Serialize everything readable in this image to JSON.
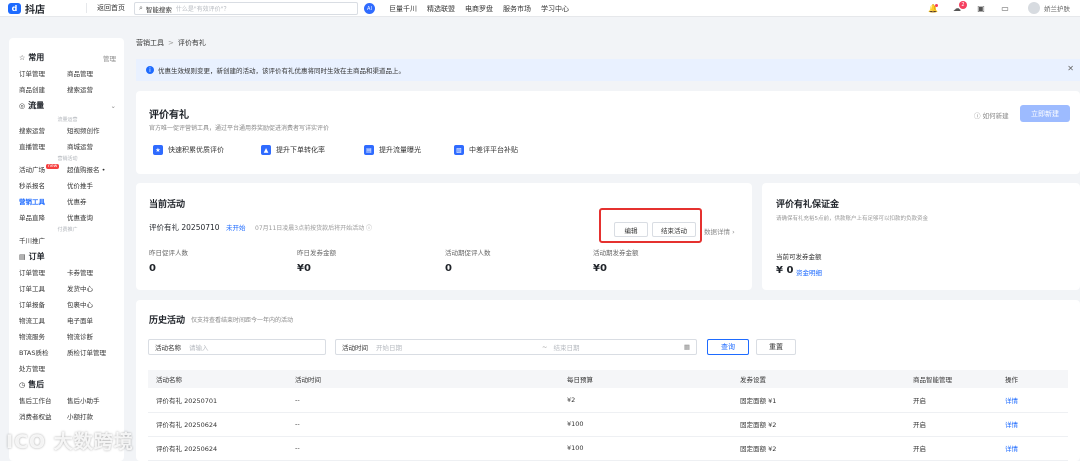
{
  "topbar": {
    "logo_text": "抖店",
    "back_home": "返回首页",
    "search_label": "智能搜索",
    "search_placeholder": "什么是\"有效评价\"？",
    "ai_label": "AI",
    "nav": [
      "巨量千川",
      "精选联盟",
      "电商罗盘",
      "服务市场",
      "学习中心"
    ],
    "badge_count": "2",
    "user_name": "娇兰护肤"
  },
  "sidebar": {
    "sections": [
      {
        "title": "常用",
        "right": "管理",
        "icon": "star-icon",
        "groups": [
          {
            "items": [
              "订单管理",
              "商品管理",
              "商品创建",
              "搜索运营"
            ]
          }
        ]
      },
      {
        "title": "流量",
        "right": "⌄",
        "icon": "flow-icon",
        "groups": [
          {
            "sub": "流量运营",
            "items": [
              "搜索运营",
              "短视频创作",
              "直播管理",
              "商城运营"
            ]
          },
          {
            "sub": "营销活动",
            "items": [
              "活动广场",
              "超值购报名 •",
              "秒杀报名",
              "优价推手",
              "营销工具",
              "优惠券",
              "单品直降",
              "优惠查询"
            ]
          },
          {
            "sub": "付费推广",
            "items": [
              "千川推广"
            ]
          }
        ]
      },
      {
        "title": "订单",
        "right": "",
        "icon": "order-icon",
        "groups": [
          {
            "items": [
              "订单管理",
              "卡券管理",
              "订单工具",
              "发货中心",
              "订单报备",
              "包裹中心",
              "物流工具",
              "电子面单",
              "物流服务",
              "物流诊断",
              "BTAS质检",
              "质检订单管理",
              "处方管理"
            ]
          }
        ]
      },
      {
        "title": "售后",
        "right": "",
        "icon": "aftersale-icon",
        "groups": [
          {
            "items": [
              "售后工作台",
              "售后小助手",
              "消费者权益",
              "小额打款"
            ]
          }
        ]
      }
    ]
  },
  "breadcrumb": {
    "parent": "营销工具",
    "sep": ">",
    "current": "评价有礼"
  },
  "notice": {
    "text": "优惠生效规则变更，新创建的活动，该评价有礼优惠将同时生效在主商品和渠道品上。",
    "close": "✕"
  },
  "header": {
    "title": "评价有礼",
    "desc": "官方唯一促评营销工具，通过平台通用券奖励促进消费者写详实评价",
    "how_to": "如何新建",
    "create_btn": "立即新建",
    "features": [
      "快速积累优质评价",
      "提升下单转化率",
      "提升流量曝光",
      "中差评平台补贴"
    ]
  },
  "current": {
    "title": "当前活动",
    "activity_name": "评价有礼 20250710",
    "status": "未开始",
    "start_note": "07月11日凌晨3点前按货款后将开始活动",
    "edit_btn": "编辑",
    "end_btn": "结束活动",
    "detail_link": "数据详情",
    "stats": [
      {
        "label": "昨日促评人数",
        "value": "0"
      },
      {
        "label": "昨日发券金额",
        "value": "¥0"
      },
      {
        "label": "活动期促评人数",
        "value": "0"
      },
      {
        "label": "活动期发券金额",
        "value": "¥0"
      }
    ]
  },
  "deposit": {
    "title": "评价有礼保证金",
    "desc": "请确保有礼充裕5点前，供款账户上有足够可以扣款的负款资金",
    "label": "当前可发券金额",
    "value": "¥ 0",
    "link": "资金明细"
  },
  "history": {
    "title": "历史活动",
    "subtitle": "仅支持查看结束时间距今一年内的活动",
    "name_label": "活动名称",
    "name_placeholder": "请输入",
    "time_label": "活动时间",
    "start_placeholder": "开始日期",
    "end_placeholder": "结束日期",
    "date_sep": "~",
    "query_btn": "查询",
    "reset_btn": "重置",
    "columns": [
      "活动名称",
      "活动时间",
      "每日预算",
      "发券设置",
      "商品智能管理",
      "操作"
    ],
    "rows": [
      [
        "评价有礼 20250701",
        "--",
        "¥2",
        "固定面额 ¥1",
        "开启",
        "详情"
      ],
      [
        "评价有礼 20250624",
        "--",
        "¥100",
        "固定面额 ¥2",
        "开启",
        "详情"
      ],
      [
        "评价有礼 20250624",
        "--",
        "¥100",
        "固定面额 ¥2",
        "开启",
        "详情"
      ]
    ]
  },
  "watermark": "ICO 大数跨境",
  "colors": {
    "accent": "#1e6bff",
    "highlight": "#e5312f"
  }
}
